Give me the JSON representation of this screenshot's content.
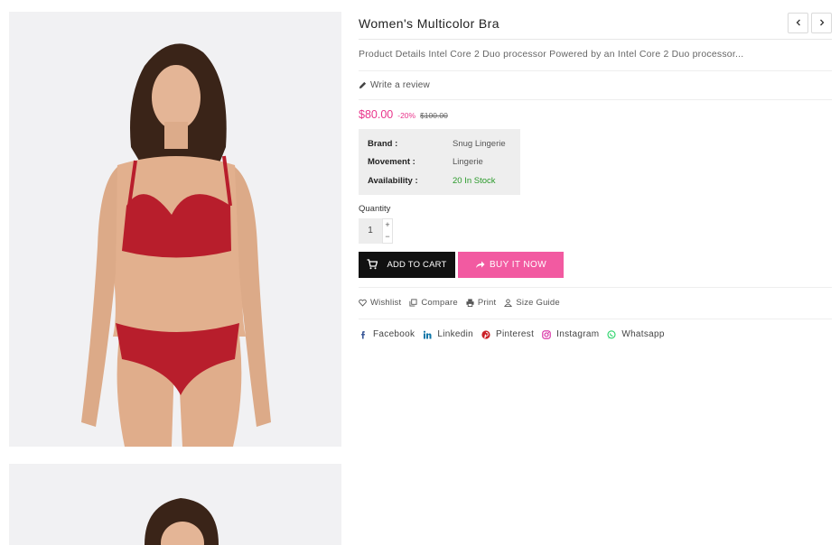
{
  "product": {
    "title": "Women's Multicolor Bra",
    "description": "Product Details Intel Core 2 Duo processor Powered by an Intel Core 2 Duo processor...",
    "review_link": "Write a review",
    "price": "$80.00",
    "discount": "-20%",
    "old_price": "$100.00"
  },
  "specs": [
    {
      "label": "Brand :",
      "value": "Snug Lingerie"
    },
    {
      "label": "Movement :",
      "value": "Lingerie"
    },
    {
      "label": "Availability :",
      "value": "20 In Stock"
    }
  ],
  "quantity": {
    "label": "Quantity",
    "value": "1",
    "plus": "+",
    "minus": "−"
  },
  "buttons": {
    "add_to_cart": "ADD TO CART",
    "buy_now": "BUY IT NOW"
  },
  "actions": {
    "wishlist": "Wishlist",
    "compare": "Compare",
    "print": "Print",
    "size_guide": "Size Guide"
  },
  "social": {
    "facebook": "Facebook",
    "linkedin": "Linkedin",
    "pinterest": "Pinterest",
    "instagram": "Instagram",
    "whatsapp": "Whatsapp"
  },
  "colors": {
    "accent": "#e9348b",
    "buy_button": "#f25aa1",
    "cart_button": "#111111",
    "in_stock": "#2a9a2a",
    "facebook": "#3b5998",
    "linkedin": "#0e76a8",
    "pinterest": "#cb2027",
    "instagram": "#d6249f",
    "whatsapp": "#25d366"
  },
  "icons": {
    "nav_prev": "chevron-left-icon",
    "nav_next": "chevron-right-icon",
    "review": "pencil-icon",
    "cart": "cart-icon",
    "buy": "share-arrow-icon",
    "wishlist": "heart-icon",
    "compare": "copy-icon",
    "print": "printer-icon",
    "size_guide": "person-icon"
  }
}
